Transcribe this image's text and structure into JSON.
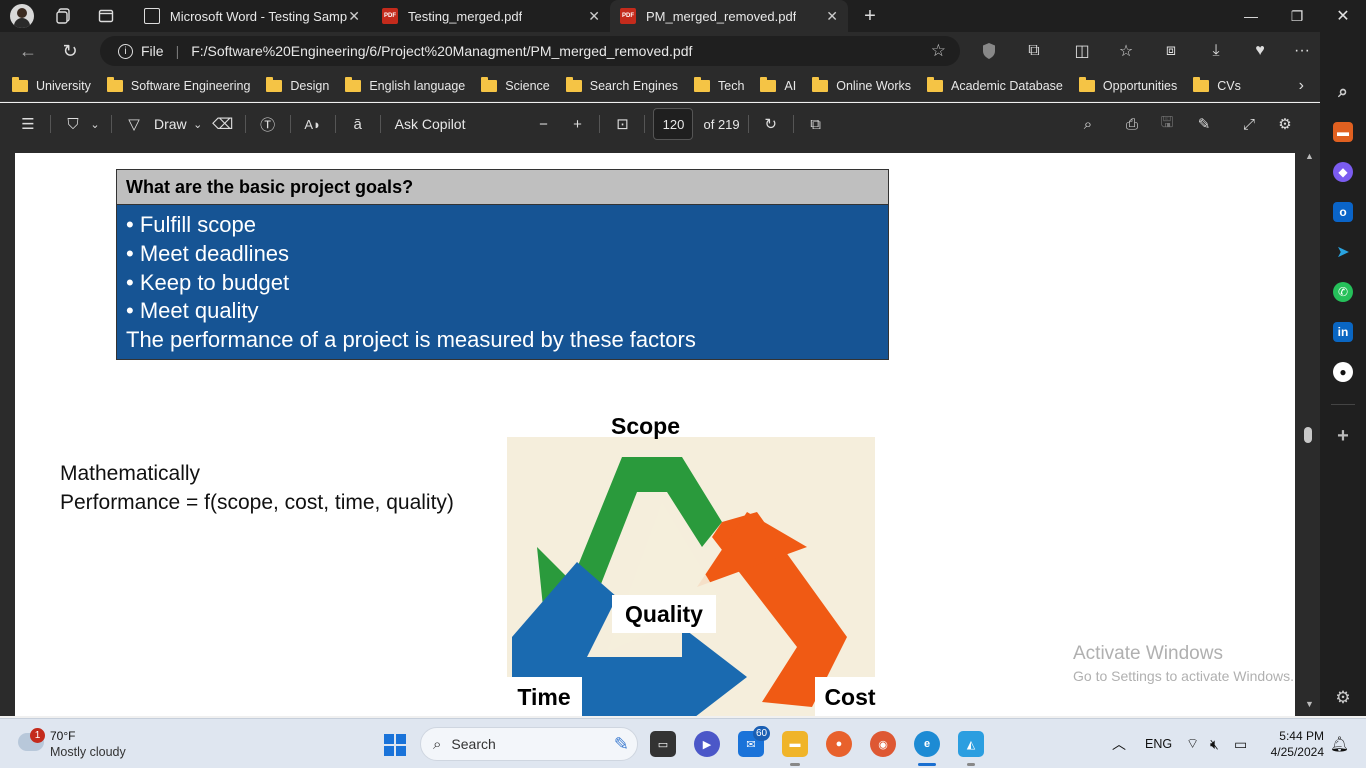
{
  "browser": {
    "tabs": [
      {
        "label": "Microsoft Word - Testing Sample",
        "favicon": "document-icon"
      },
      {
        "label": "Testing_merged.pdf",
        "favicon": "pdf-icon"
      },
      {
        "label": "PM_merged_removed.pdf",
        "favicon": "pdf-icon",
        "active": true
      }
    ],
    "address": {
      "file_label": "File",
      "url": "F:/Software%20Engineering/6/Project%20Managment/PM_merged_removed.pdf"
    },
    "favorites": [
      "University",
      "Software Engineering",
      "Design",
      "English language",
      "Science",
      "Search Engines",
      "Tech",
      "AI",
      "Online Works",
      "Academic Database",
      "Opportunities",
      "CVs"
    ]
  },
  "pdf_toolbar": {
    "draw_label": "Draw",
    "copilot_label": "Ask Copilot",
    "page_number": "120",
    "page_total": "of 219"
  },
  "document": {
    "goals_title": "What are the basic project goals?",
    "goals": [
      "Fulfill scope",
      "Meet deadlines",
      "Keep to budget",
      "Meet quality"
    ],
    "goals_footer": "The performance of a project is measured by these factors",
    "math_line1": "Mathematically",
    "math_line2": "Performance = f(scope, cost, time, quality)",
    "diagram_labels": {
      "scope": "Scope",
      "quality": "Quality",
      "time": "Time",
      "cost": "Cost"
    }
  },
  "watermark": {
    "line1": "Activate Windows",
    "line2": "Go to Settings to activate Windows."
  },
  "taskbar": {
    "weather_temp": "70°F",
    "weather_desc": "Mostly cloudy",
    "weather_badge": "1",
    "search_placeholder": "Search",
    "mail_badge": "60",
    "language": "ENG",
    "time": "5:44 PM",
    "date": "4/25/2024"
  },
  "colors": {
    "goal_box_blue": "#165494",
    "goal_header_gray": "#bfbfbf",
    "arrow_green": "#2a9a3c",
    "arrow_orange": "#f05a14",
    "arrow_blue": "#1a6ab0"
  }
}
